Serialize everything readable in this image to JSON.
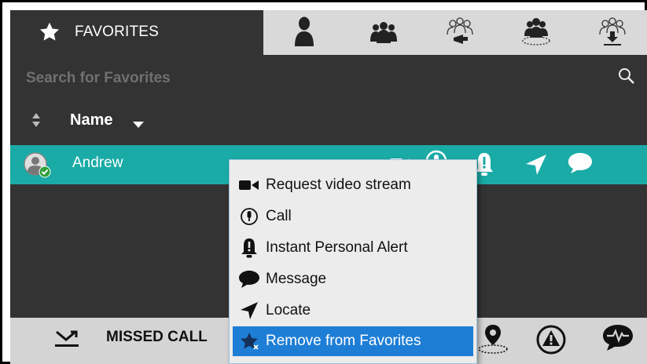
{
  "tabs": {
    "active_label": "FAVORITES",
    "icons": [
      "person-icon",
      "group-icon",
      "broadcast-group-icon",
      "area-group-icon",
      "download-group-icon"
    ]
  },
  "search": {
    "placeholder": "Search for Favorites"
  },
  "list": {
    "column_header": "Name",
    "contacts": [
      {
        "name": "Andrew",
        "status": "online"
      }
    ]
  },
  "context_menu": {
    "items": [
      {
        "label": "Request video stream",
        "icon": "video-camera-icon"
      },
      {
        "label": "Call",
        "icon": "microphone-icon"
      },
      {
        "label": "Instant Personal Alert",
        "icon": "bell-alert-icon"
      },
      {
        "label": "Message",
        "icon": "chat-bubble-icon"
      },
      {
        "label": "Locate",
        "icon": "locate-arrow-icon"
      },
      {
        "label": "Remove from Favorites",
        "icon": "remove-star-icon",
        "selected": true
      }
    ]
  },
  "bottom_bar": {
    "missed_label": "MISSED CALL",
    "icons": [
      "missed-call-icon",
      "location-pin-icon",
      "emergency-alert-icon",
      "heartbeat-message-icon"
    ]
  },
  "colors": {
    "panel_bg": "#333333",
    "selected_row": "#1aaba6",
    "menu_highlight": "#1e7ed6",
    "tab_bar": "#d9d9d9"
  }
}
